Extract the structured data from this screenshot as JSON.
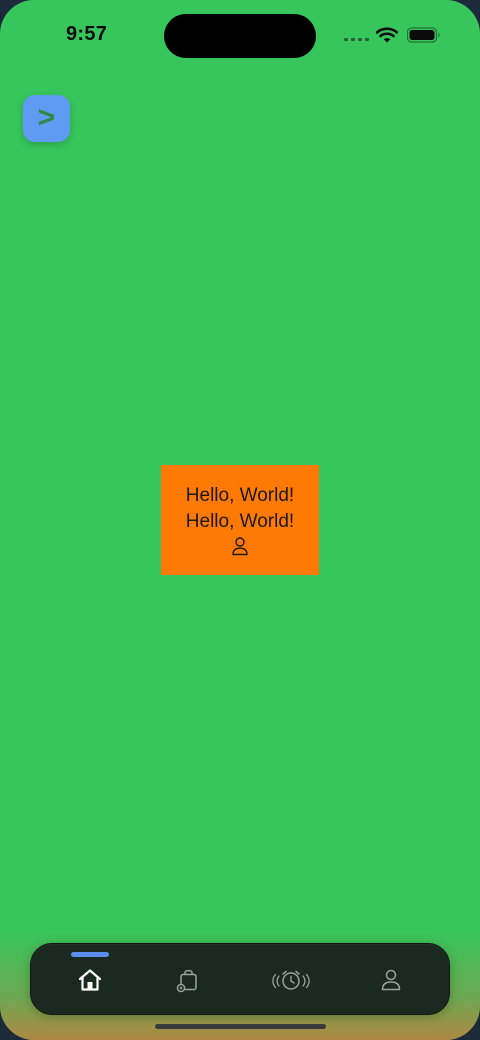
{
  "status_bar": {
    "time": "9:57"
  },
  "fab": {
    "label": ">"
  },
  "card": {
    "line1": "Hello, World!",
    "line2": "Hello, World!",
    "icon": "person-icon"
  },
  "tab_bar": {
    "tabs": [
      {
        "name": "home",
        "icon": "home-icon",
        "selected": true
      },
      {
        "name": "orders",
        "icon": "bag-icon",
        "selected": false
      },
      {
        "name": "alarm",
        "icon": "alarm-clock-icon",
        "selected": false
      },
      {
        "name": "profile",
        "icon": "person-icon",
        "selected": false
      }
    ]
  },
  "colors": {
    "background": "#37c65c",
    "fab": "#5f9bf2",
    "card": "#ff7a04",
    "tab_bar": "#1b2a20",
    "tab_indicator": "#5b8ef0"
  }
}
